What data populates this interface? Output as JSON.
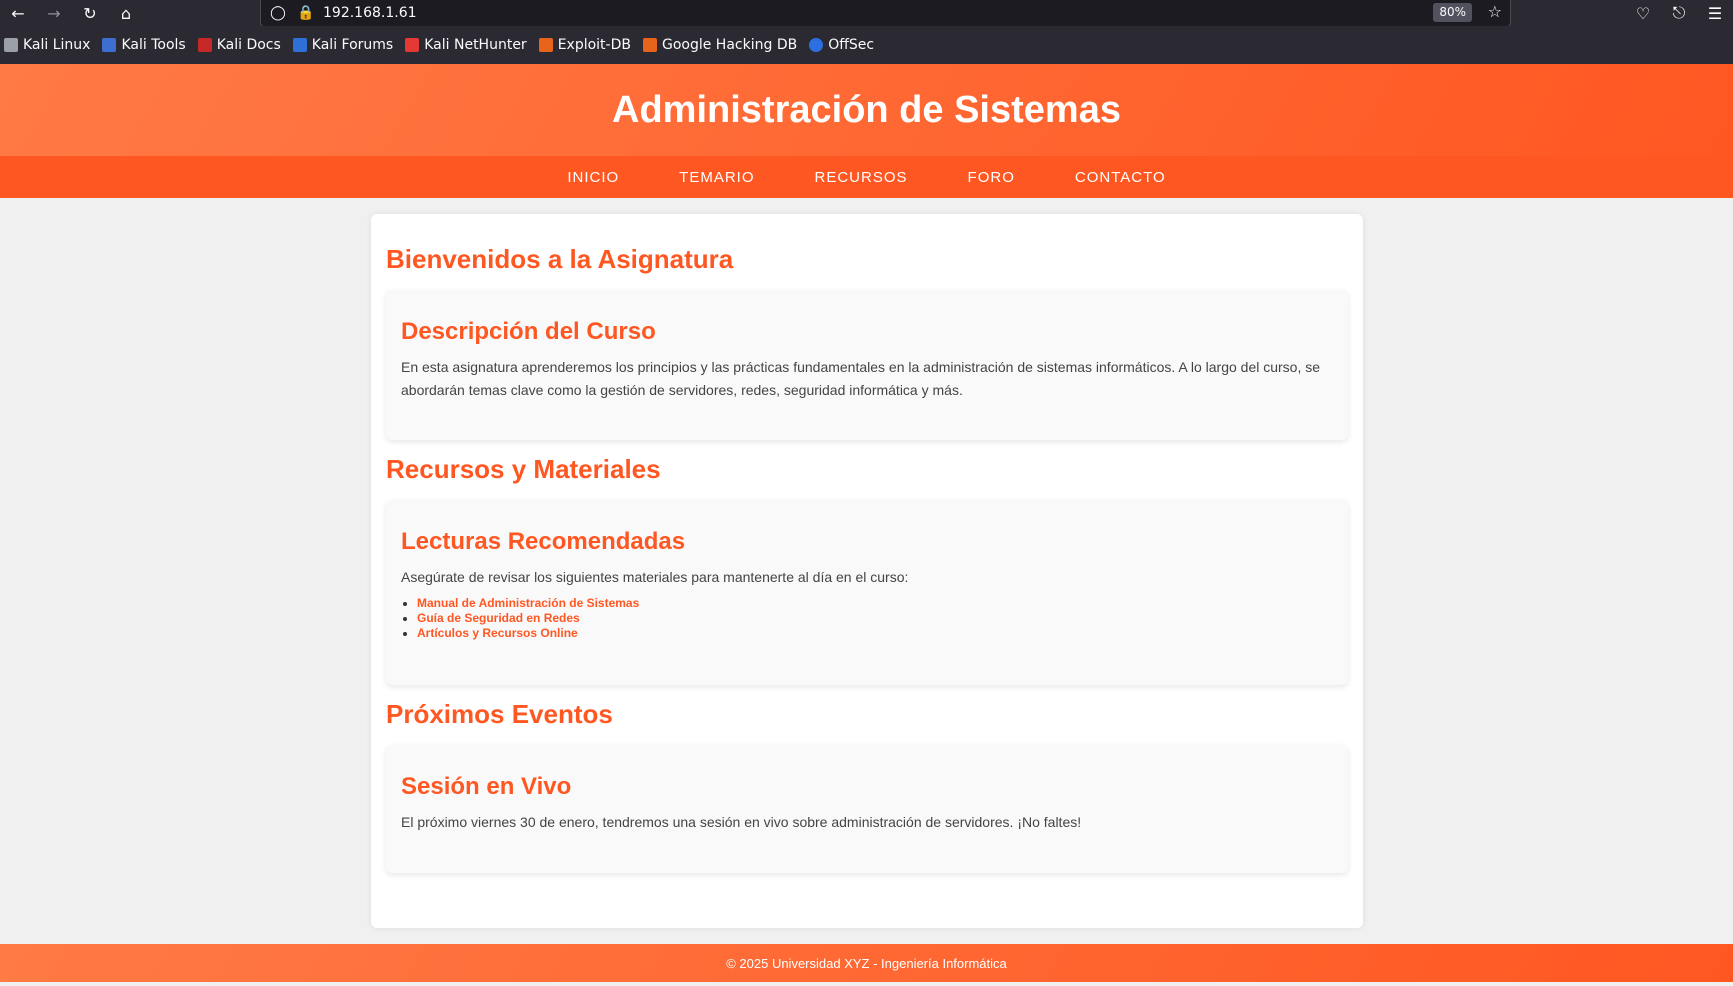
{
  "browser": {
    "url": "192.168.1.61",
    "zoom": "80%",
    "icons": {
      "back": "arrow-left-icon",
      "forward": "arrow-right-icon",
      "reload": "reload-icon",
      "home": "home-icon",
      "shield": "shield-icon",
      "lock": "lock-icon",
      "star": "star-icon",
      "pocket": "pocket-icon",
      "extensions": "extensions-icon",
      "menu": "menu-icon"
    },
    "bookmarks": [
      {
        "label": "Kali Linux",
        "color": "#9aa0a6"
      },
      {
        "label": "Kali Tools",
        "color": "#3d6fd1"
      },
      {
        "label": "Kali Docs",
        "color": "#c62828"
      },
      {
        "label": "Kali Forums",
        "color": "#2e6fd8"
      },
      {
        "label": "Kali NetHunter",
        "color": "#e53935"
      },
      {
        "label": "Exploit-DB",
        "color": "#e8641b"
      },
      {
        "label": "Google Hacking DB",
        "color": "#e8641b"
      },
      {
        "label": "OffSec",
        "color": "#2c6fe0"
      }
    ]
  },
  "site": {
    "title": "Administración de Sistemas",
    "nav": [
      "INICIO",
      "TEMARIO",
      "RECURSOS",
      "FORO",
      "CONTACTO"
    ],
    "sections": [
      {
        "title": "Bienvenidos a la Asignatura",
        "card_title": "Descripción del Curso",
        "card_text": "En esta asignatura aprenderemos los principios y las prácticas fundamentales en la administración de sistemas informáticos. A lo largo del curso, se abordarán temas clave como la gestión de servidores, redes, seguridad informática y más."
      },
      {
        "title": "Recursos y Materiales",
        "card_title": "Lecturas Recomendadas",
        "card_text": "Asegúrate de revisar los siguientes materiales para mantenerte al día en el curso:",
        "links": [
          "Manual de Administración de Sistemas",
          "Guía de Seguridad en Redes",
          "Artículos y Recursos Online"
        ]
      },
      {
        "title": "Próximos Eventos",
        "card_title": "Sesión en Vivo",
        "card_text": "El próximo viernes 30 de enero, tendremos una sesión en vivo sobre administración de servidores. ¡No faltes!"
      }
    ],
    "footer": "© 2025 Universidad XYZ - Ingeniería Informática",
    "colors": {
      "accent": "#ff5722",
      "accent_light": "#ff7a45"
    }
  }
}
